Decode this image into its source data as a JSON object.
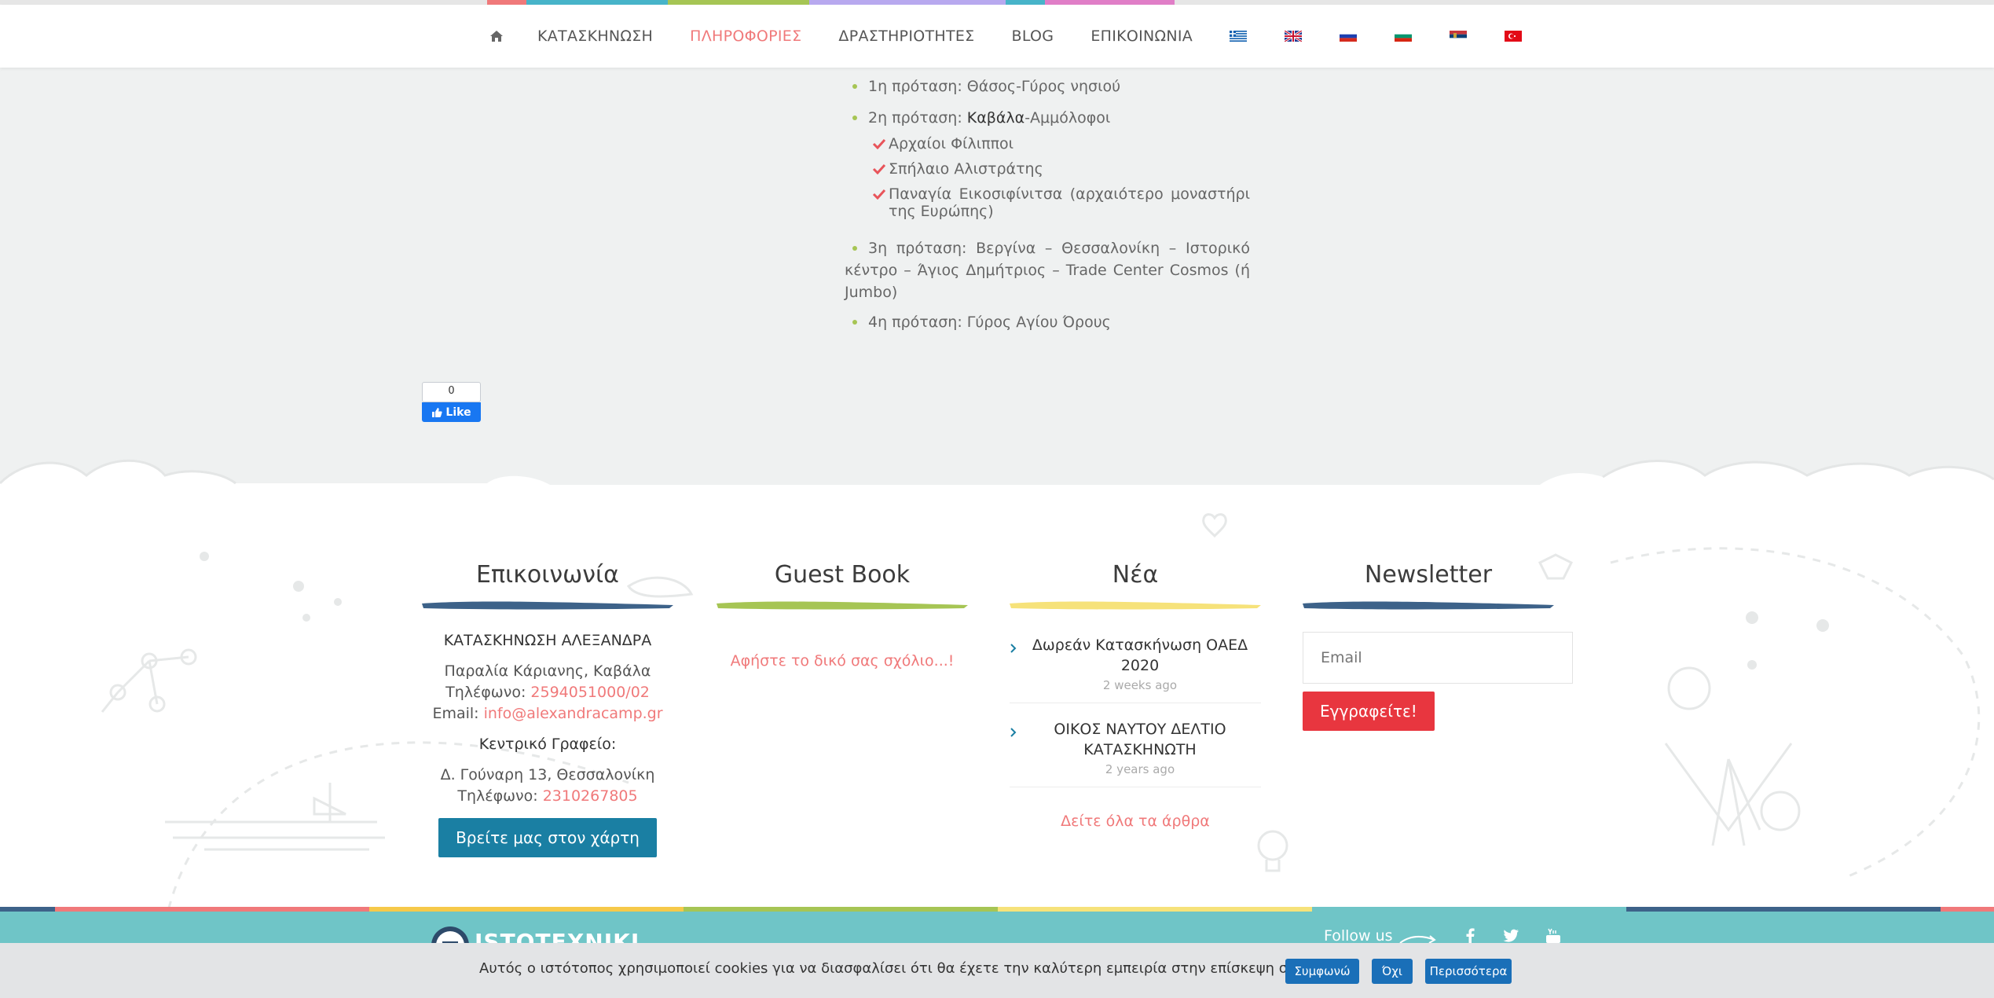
{
  "colors": {
    "accent": "#f0797a",
    "bullet_green": "#a6c554",
    "map_button": "#1a7fa3",
    "subscribe_button": "#e8363f",
    "band_teal": "#6fc5c7",
    "cookie_button": "#1a6fb8",
    "strip": [
      "#f0797a",
      "#47b4c9",
      "#a6c554",
      "#b8a9ef",
      "#47b4c9",
      "#e07ec7"
    ]
  },
  "nav": {
    "home_icon": "home-icon",
    "items": [
      {
        "label": "ΚΑΤΑΣΚΗΝΩΣΗ"
      },
      {
        "label": "ΠΛΗΡΟΦΟΡΙΕΣ",
        "active": true
      },
      {
        "label": "ΔΡΑΣΤΗΡΙΟΤΗΤΕΣ"
      },
      {
        "label": "BLOG"
      },
      {
        "label": "ΕΠΙΚΟΙΝΩΝΙΑ"
      }
    ],
    "flags": [
      "greece-flag-icon",
      "uk-flag-icon",
      "russia-flag-icon",
      "bulgaria-flag-icon",
      "serbia-flag-icon",
      "turkey-flag-icon"
    ]
  },
  "content": {
    "p1": "1η πρόταση: Θάσος-Γύρος νησιού",
    "p2_prefix": "2η πρόταση: ",
    "p2_strong": "Καβάλα",
    "p2_suffix": "-Αμμόλοφοι",
    "sub": [
      "Αρχαίοι Φίλιπποι",
      "Σπήλαιο Αλιστράτης",
      "Παναγία Εικοσιφίνιτσα (αρχαιότερο μοναστήρι της Ευρώπης)"
    ],
    "p3": "3η πρόταση: Βεργίνα – Θεσσαλονίκη – Ιστορικό κέντρο – Άγιος Δημήτριος – Trade Center Cosmos (ή Jumbo)",
    "p4": "4η πρόταση: Γύρος Αγίου Όρους"
  },
  "fb": {
    "count": "0",
    "label": "Like"
  },
  "footer": {
    "contact": {
      "title": "Επικοινωνία",
      "camp_name": "ΚΑΤΑΣΚΗΝΩΣΗ ΑΛΕΞΑΝΔΡΑ",
      "address": "Παραλία Κάριανης, Καβάλα",
      "phone_label": "Τηλέφωνο: ",
      "phone": "2594051000/02",
      "email_label": "Email: ",
      "email": "info@alexandracamp.gr",
      "office_label": "Κεντρικό Γραφείο:",
      "office_address": "Δ. Γούναρη 13, Θεσσαλονίκη",
      "office_phone_label": "Τηλέφωνο: ",
      "office_phone": "2310267805",
      "map_button": "Βρείτε μας στον χάρτη"
    },
    "guestbook": {
      "title": "Guest Book",
      "link": "Αφήστε το δικό σας σχόλιο...!"
    },
    "news": {
      "title": "Νέα",
      "items": [
        {
          "title": "Δωρεάν Κατασκήνωση ΟΑΕΔ 2020",
          "date": "2 weeks ago"
        },
        {
          "title": "ΟΙΚΟΣ ΝΑΥΤΟΥ ΔΕΛΤΙΟ ΚΑΤΑΣΚΗΝΩΤΗ",
          "date": "2 years ago"
        }
      ],
      "all_link": "Δείτε όλα τα άρθρα"
    },
    "newsletter": {
      "title": "Newsletter",
      "placeholder": "Email",
      "button": "Εγγραφείτε!"
    }
  },
  "band": {
    "logo_text": "ISTOTEXNIKI",
    "follow": "Follow us",
    "social": [
      "facebook-icon",
      "twitter-icon",
      "youtube-icon"
    ]
  },
  "cookie": {
    "text": "Αυτός ο ιστότοπος χρησιμοποιεί cookies για να διασφαλίσει ότι θα έχετε την καλύτερη εμπειρία στην επίσκεψη σας",
    "agree": "Συμφωνώ",
    "no": "Όχι",
    "more": "Περισσότερα"
  }
}
